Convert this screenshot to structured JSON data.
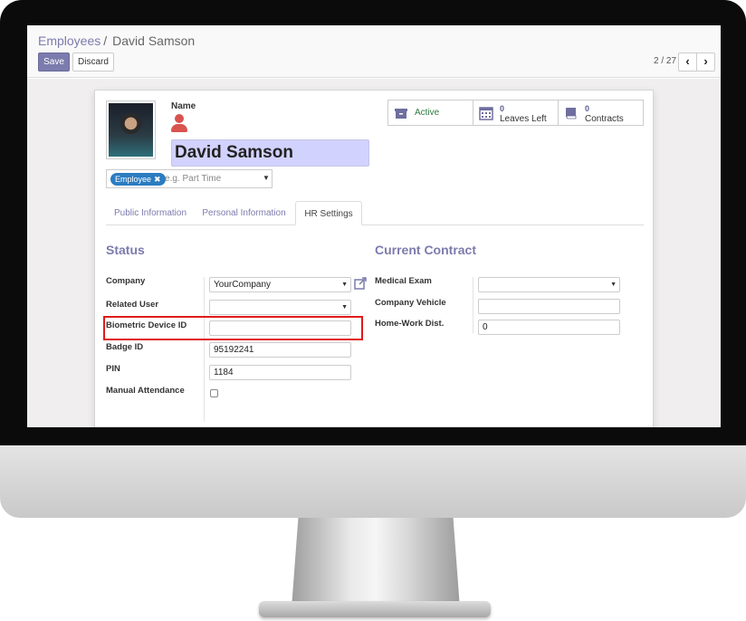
{
  "breadcrumb": {
    "parent": "Employees",
    "separator": "/",
    "current": "David Samson"
  },
  "toolbar": {
    "save_label": "Save",
    "discard_label": "Discard"
  },
  "pager": {
    "text": "2 / 27",
    "prev": "‹",
    "next": "›"
  },
  "employee": {
    "name_label": "Name",
    "name": "David Samson",
    "tag": "Employee",
    "tag_remove": "✖",
    "tags_placeholder": "e.g. Part Time"
  },
  "smart_buttons": {
    "active": {
      "label": "Active",
      "icon": "archive-icon"
    },
    "leaves": {
      "count": "0",
      "label": "Leaves Left",
      "icon": "calendar-icon"
    },
    "contracts": {
      "count": "0",
      "label": "Contracts",
      "icon": "book-icon"
    }
  },
  "tabs": [
    "Public Information",
    "Personal Information",
    "HR Settings"
  ],
  "status": {
    "title": "Status",
    "company_label": "Company",
    "company_value": "YourCompany",
    "related_user_label": "Related User",
    "related_user_value": "",
    "biometric_label": "Biometric Device ID",
    "biometric_value": "",
    "badge_label": "Badge ID",
    "badge_value": "95192241",
    "pin_label": "PIN",
    "pin_value": "1184",
    "manual_label": "Manual Attendance",
    "manual_checked": false
  },
  "contract": {
    "title": "Current Contract",
    "medical_label": "Medical Exam",
    "medical_value": "",
    "vehicle_label": "Company Vehicle",
    "vehicle_value": "",
    "distance_label": "Home-Work Dist.",
    "distance_value": "0"
  },
  "colors": {
    "accent": "#7c7bad",
    "highlight": "#e01b1b",
    "name_bg": "#d2d2ff",
    "tag": "#2b7cc1",
    "alert_icon": "#d9534f"
  }
}
